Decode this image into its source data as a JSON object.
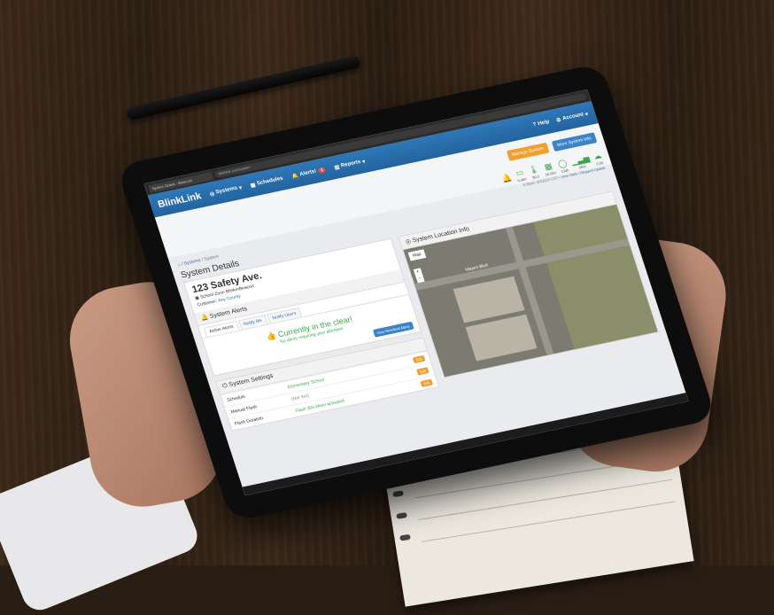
{
  "browser": {
    "tab_title": "System Details - BlinkLink",
    "url": "blinklink.com/system"
  },
  "navbar": {
    "brand": "BlinkLink",
    "items": [
      "Systems",
      "Schedules",
      "Alerts!",
      "Reports"
    ],
    "alert_count": "1",
    "help": "Help",
    "account": "Account"
  },
  "actions": {
    "manage": "Manage System",
    "more": "More System Info"
  },
  "status": {
    "values": [
      "5.08V",
      "80.2",
      "16.05V",
      "13db",
      "56%",
      "0.00"
    ],
    "updated": "8:36pm, 8/3/2022 CST",
    "view_stats": "View Stats",
    "request_update": "Request Update"
  },
  "breadcrumb": {
    "home": "Systems",
    "current": "System"
  },
  "page_title": "System Details",
  "system": {
    "address": "123 Safety Ave.",
    "type": "School Zone BlinkerBeacon",
    "customer_label": "Customer:",
    "customer": "Any County"
  },
  "alerts": {
    "title": "System Alerts",
    "tabs": [
      "Active Alerts",
      "Notify Me",
      "Notify Users"
    ],
    "headline": "Currently in the clear!",
    "subline": "No alerts requiring your attention",
    "view_button": "View Resolved Alerts"
  },
  "settings": {
    "title": "System Settings",
    "rows": [
      {
        "key": "Schedule",
        "value": "Elementary School"
      },
      {
        "key": "Manual Flash",
        "value": "(Not Set)"
      },
      {
        "key": "Flash Duration",
        "value": "Flash 30s when activated"
      }
    ],
    "edit": "Edit"
  },
  "location": {
    "title": "System Location Info",
    "map_tab": "Map",
    "road": "Mayes Blvd"
  },
  "colors": {
    "nav": "#2f78b8",
    "accent_orange": "#f0a030",
    "ok_green": "#3aa84a"
  }
}
